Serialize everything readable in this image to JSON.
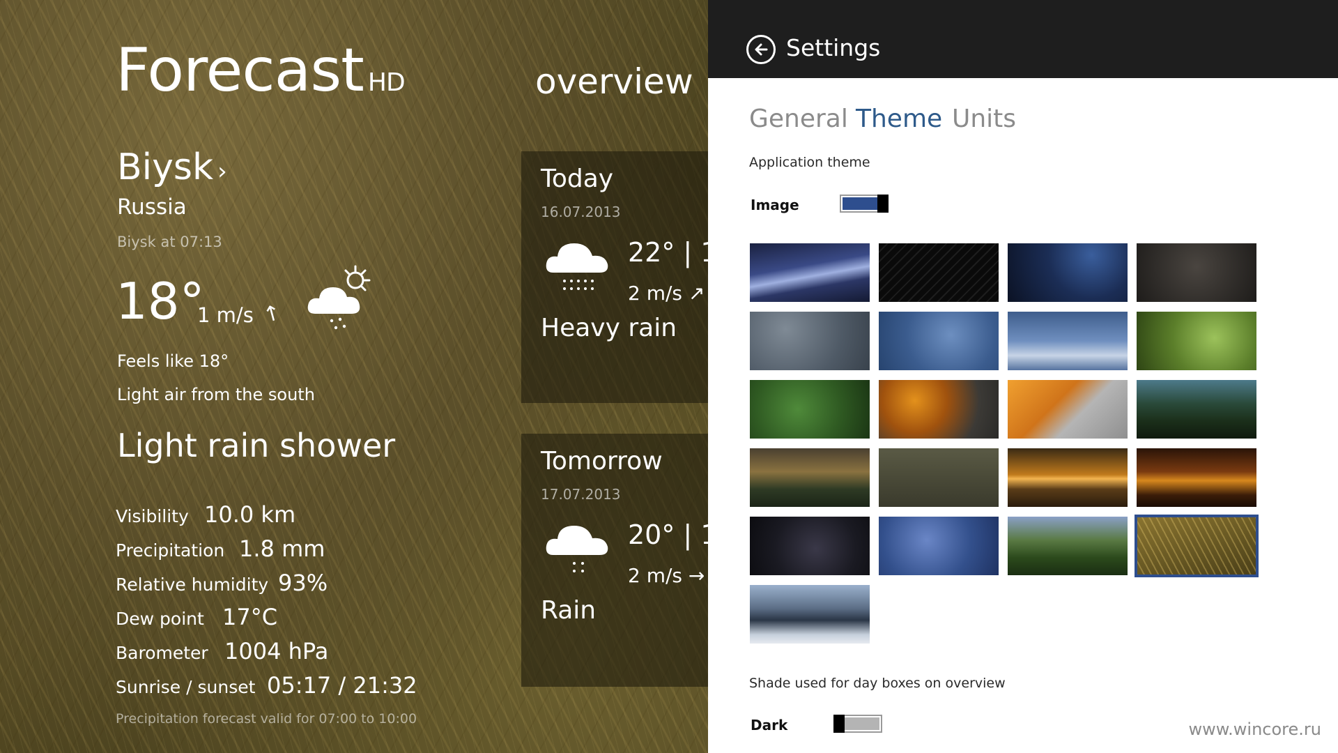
{
  "app": {
    "title": "Forecast",
    "title_suffix": "HD",
    "section": "overview"
  },
  "current": {
    "city": "Biysk",
    "city_chevron": "›",
    "country": "Russia",
    "observed": "Biysk at 07:13",
    "temperature": "18°",
    "wind": "1 m/s",
    "wind_arrow": "↑",
    "icon": "partly-cloudy-drizzle-icon",
    "feels_like": "Feels like 18°",
    "wind_description": "Light air from the south",
    "condition": "Light rain shower",
    "details": [
      {
        "label": "Visibility",
        "value": "10.0 km"
      },
      {
        "label": "Precipitation",
        "value": "1.8 mm"
      },
      {
        "label": "Relative humidity",
        "value": "93%"
      },
      {
        "label": "Dew point",
        "value": "17°C"
      },
      {
        "label": "Barometer",
        "value": "1004 hPa"
      },
      {
        "label": "Sunrise / sunset",
        "value": "05:17 / 21:32"
      }
    ],
    "forecast_note": "Precipitation forecast valid for 07:00 to 10:00"
  },
  "days": [
    {
      "name": "Today",
      "date": "16.07.2013",
      "temps": "22° | 1",
      "wind": "2 m/s",
      "wind_arrow": "↗",
      "condition": "Heavy rain",
      "icon": "cloud-heavy-rain-icon"
    },
    {
      "name": "Tomorrow",
      "date": "17.07.2013",
      "temps": "20° | 1",
      "wind": "2 m/s",
      "wind_arrow": "→",
      "condition": "Rain",
      "icon": "cloud-rain-icon"
    }
  ],
  "settings": {
    "title": "Settings",
    "tabs": [
      {
        "label": "General",
        "active": false
      },
      {
        "label": "Theme",
        "active": true
      },
      {
        "label": "Units",
        "active": false
      }
    ],
    "app_theme_label": "Application theme",
    "image_toggle_label": "Image",
    "image_toggle_on": true,
    "shade_label": "Shade used for day boxes on overview",
    "shade_toggle_label": "Dark",
    "shade_toggle_on": false,
    "selected_theme_index": 19,
    "theme_count": 21
  },
  "watermark": "www.wincore.ru",
  "colors": {
    "accent": "#2e5a8a",
    "toggle_on": "#2e4e8e",
    "header_bg": "#1e1e1e",
    "inactive_tab": "#8b8b8b"
  }
}
